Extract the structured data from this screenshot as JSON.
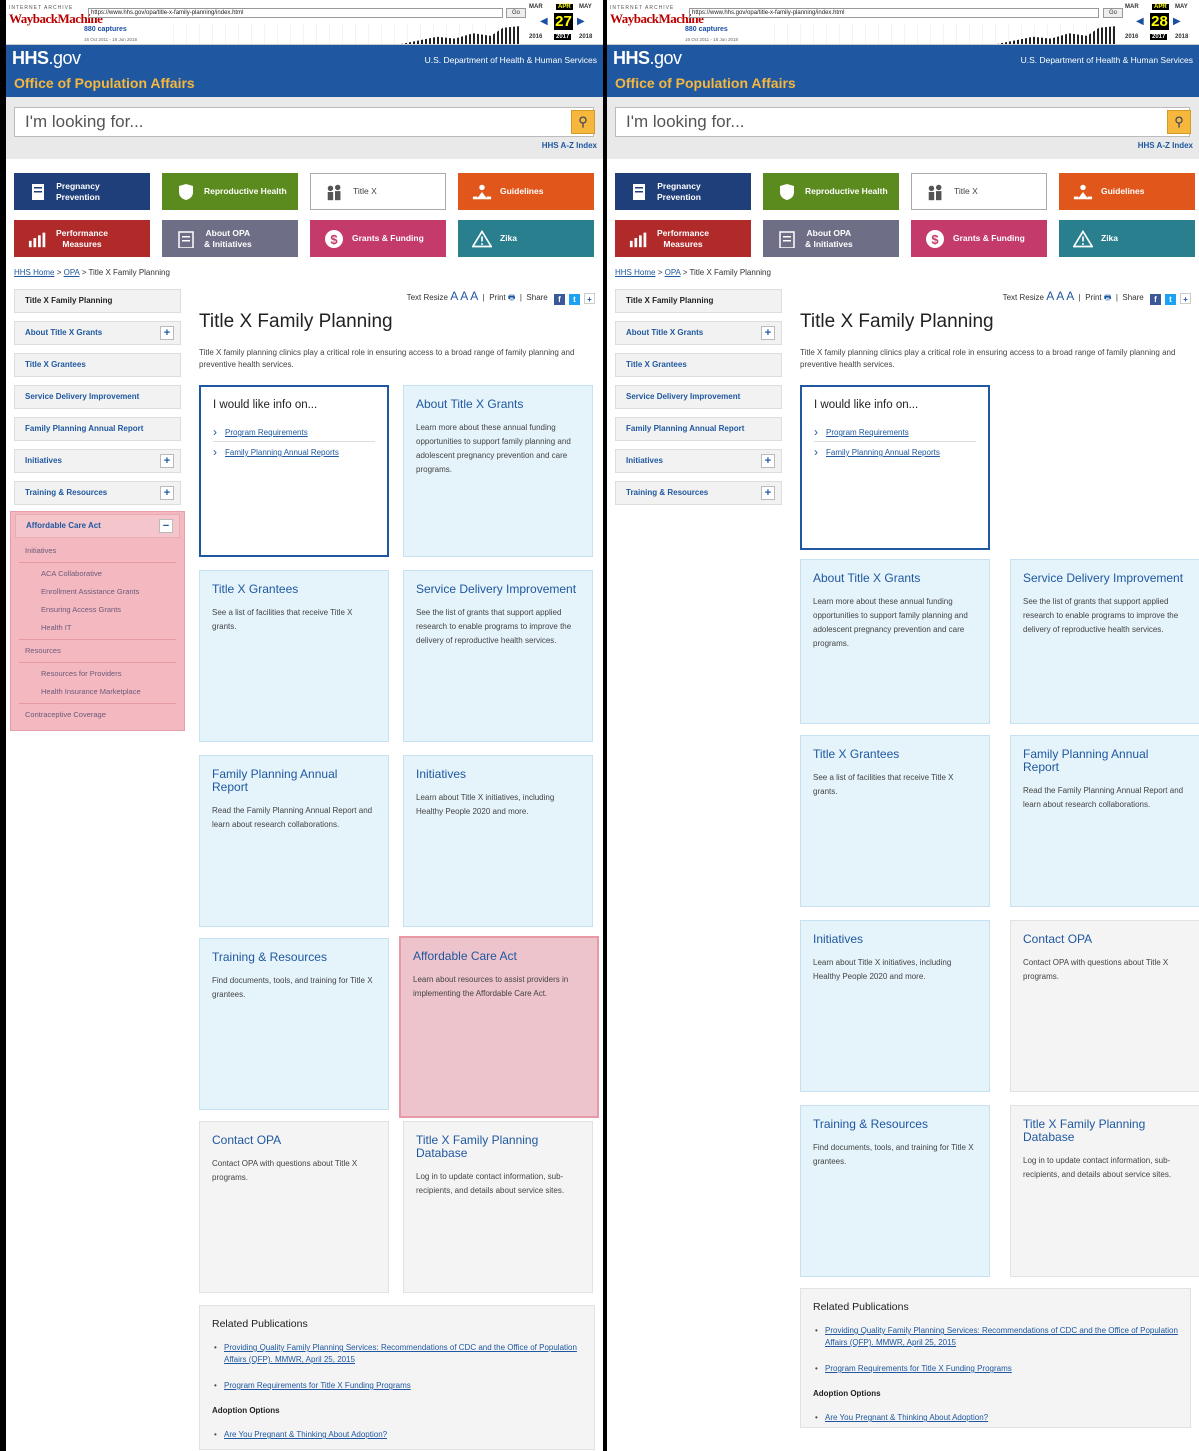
{
  "wayback": {
    "brand_small": "INTERNET ARCHIVE",
    "brand": "WaybackMachine",
    "go": "Go",
    "captures": "880 captures",
    "range": "16 Oct 2011 - 18 Jun 2018",
    "months": [
      "MAR",
      "APR",
      "MAY"
    ],
    "years": [
      "2016",
      "2017",
      "2018"
    ]
  },
  "left": {
    "url": "https://www.hhs.gov/opa/title-x-family-planning/index.html",
    "day": "27"
  },
  "right": {
    "url": "https://www.hhs.gov/opa/title-x-family-planning/index.html",
    "day": "28"
  },
  "header": {
    "logo": "HHS",
    "logo_suffix": ".gov",
    "dept": "U.S. Department of Health & Human Services",
    "office": "Office of Population Affairs"
  },
  "search": {
    "placeholder": "I'm looking for...",
    "az": "HHS A-Z Index"
  },
  "tiles": [
    {
      "l1": "Pregnancy",
      "l2": "Prevention",
      "color": "#1f3f7a"
    },
    {
      "l1": "Reproductive Health",
      "l2": "",
      "color": "#5b8a1e"
    },
    {
      "l1": "Title X",
      "l2": "",
      "color": "#ffffff"
    },
    {
      "l1": "Guidelines",
      "l2": "",
      "color": "#e0561b"
    },
    {
      "l1": "Performance",
      "l2": "Measures",
      "color": "#b12a2a"
    },
    {
      "l1": "About OPA",
      "l2": "& Initiatives",
      "color": "#6e6e86"
    },
    {
      "l1": "Grants & Funding",
      "l2": "",
      "color": "#c43a6a"
    },
    {
      "l1": "Zika",
      "l2": "",
      "color": "#2a7f8f"
    }
  ],
  "breadcrumb": {
    "home": "HHS Home",
    "opa": "OPA",
    "current": "Title X Family Planning",
    "sep": ">"
  },
  "sidebar": [
    "Title X Family Planning",
    "About Title X Grants",
    "Title X Grantees",
    "Service Delivery Improvement",
    "Family Planning Annual Report",
    "Initiatives",
    "Training & Resources"
  ],
  "aca": {
    "title": "Affordable Care Act",
    "minus": "−",
    "initiatives": "Initiatives",
    "init_items": [
      "ACA Collaborative",
      "Enrollment Assistance Grants",
      "Ensuring Access Grants",
      "Health IT"
    ],
    "resources": "Resources",
    "res_items": [
      "Resources for Providers",
      "Health Insurance Marketplace"
    ],
    "contraceptive": "Contraceptive Coverage"
  },
  "tools": {
    "resize": "Text Resize",
    "aa": "A A A",
    "print": "Print",
    "share": "Share",
    "plus": "+",
    "fb": "f",
    "tw": "t"
  },
  "page": {
    "title": "Title X Family Planning",
    "intro": "Title X family planning clinics play a critical role in ensuring access to a broad range of family planning and preventive health services."
  },
  "info": {
    "title": "I would like info on...",
    "links": [
      "Program Requirements",
      "Family Planning Annual Reports"
    ]
  },
  "cards": {
    "about": {
      "t": "About Title X Grants",
      "d": "Learn more about these annual funding opportunities to support family planning and adolescent pregnancy prevention and care programs."
    },
    "grantees": {
      "t": "Title X Grantees",
      "d": "See a list of facilities that receive Title X grants."
    },
    "sdi": {
      "t": "Service Delivery Improvement",
      "d": "See the list of grants that support applied research to enable programs to improve the delivery of reproductive health services."
    },
    "fpar": {
      "t": "Family Planning Annual Report",
      "d": "Read the Family Planning Annual Report and learn about research collaborations."
    },
    "init": {
      "t": "Initiatives",
      "d": "Learn about Title X initiatives, including Healthy People 2020 and more."
    },
    "train": {
      "t": "Training & Resources",
      "d": "Find documents, tools, and training for Title X grantees."
    },
    "aca": {
      "t": "Affordable Care Act",
      "d": "Learn about resources to assist providers in implementing the Affordable Care Act."
    },
    "contact": {
      "t": "Contact OPA",
      "d": "Contact OPA with questions about Title X programs."
    },
    "db": {
      "t": "Title X Family Planning Database",
      "d": "Log in to update contact information, sub-recipients, and details about service sites."
    }
  },
  "pubs": {
    "title": "Related Publications",
    "l1": "Providing Quality Family Planning Services: Recommendations of CDC and the Office of Population Affairs (QFP). MMWR, April 25, 2015",
    "l2": "Program Requirements for Title X Funding Programs",
    "sub": "Adoption Options",
    "l3": "Are You Pregnant & Thinking About Adoption?"
  }
}
